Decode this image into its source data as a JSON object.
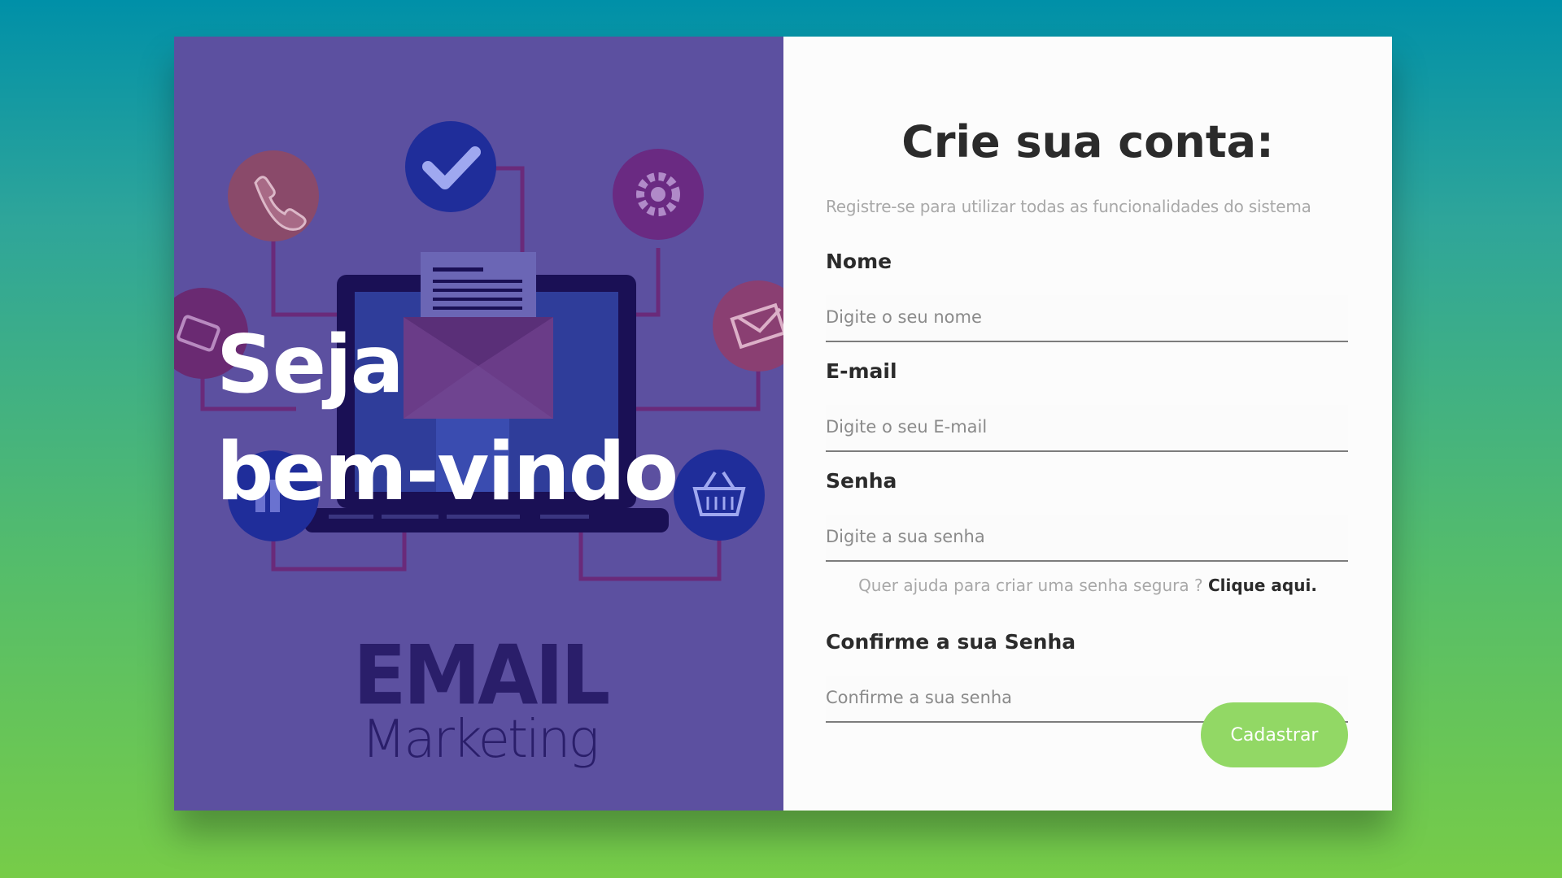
{
  "left": {
    "welcome_line1": "Seja",
    "welcome_line2": "bem-vindo",
    "brand_email": "EMAIL",
    "brand_marketing": "Marketing",
    "illustration_icons": [
      "phone-icon",
      "check-icon",
      "gear-icon",
      "money-icon",
      "envelope-icon",
      "basket-icon",
      "laptop-icon",
      "letter-icon"
    ]
  },
  "form": {
    "title": "Crie sua conta:",
    "subtitle": "Registre-se para utilizar todas as funcionalidades do sistema",
    "name_label": "Nome",
    "name_placeholder": "Digite o seu nome",
    "email_label": "E-mail",
    "email_placeholder": "Digite o seu E-mail",
    "password_label": "Senha",
    "password_placeholder": "Digite a sua senha",
    "help_text": "Quer ajuda para criar uma senha segura ? ",
    "help_link": "Clique aqui.",
    "confirm_label": "Confirme a sua Senha",
    "confirm_placeholder": "Confirme a sua senha",
    "submit_label": "Cadastrar"
  },
  "colors": {
    "left_panel": "#5c50a0",
    "submit_button": "#92d865",
    "background_top": "#0090a8",
    "background_bottom": "#77cc48"
  }
}
